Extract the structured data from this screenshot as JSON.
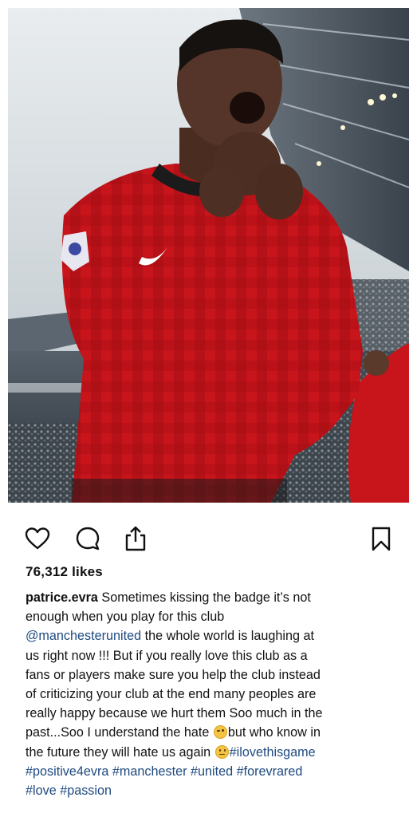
{
  "post": {
    "photo": {
      "description_icon": "photo"
    },
    "actions": {
      "like_icon": "heart-outline-icon",
      "comment_icon": "comment-bubble-icon",
      "share_icon": "share-upload-icon",
      "save_icon": "bookmark-outline-icon"
    },
    "likes": "76,312 likes",
    "caption": {
      "username": "patrice.evra",
      "line1": "Sometimes kissing the badge it’s not",
      "line2": "enough when you play for this club",
      "mention": "@manchesterunited",
      "line3_rest": "the whole world is laughing at",
      "line4": "us right now !!! But if you really love this club as a",
      "line5": "fans or players make sure you help the club instead",
      "line6": "of criticizing your club at the end many peoples are",
      "line7": "really happy because we hurt them Soo much in the",
      "line8_a": "past...Soo I understand the hate",
      "line8_b": "but who know in",
      "line9_a": "the future they will hate us again",
      "hashtags": {
        "ilovethisgame": "#ilovethisgame",
        "positive4evra": "#positive4evra",
        "manchester": "#manchester",
        "united": "#united",
        "forevrared": "#forevrared",
        "love": "#love",
        "passion": "#passion"
      },
      "emoji_wink": "winking-face-emoji",
      "emoji_neutral": "neutral-face-emoji"
    },
    "colors": {
      "link": "#1f4a80",
      "jersey_red": "#c8141b",
      "text": "#121212"
    }
  }
}
